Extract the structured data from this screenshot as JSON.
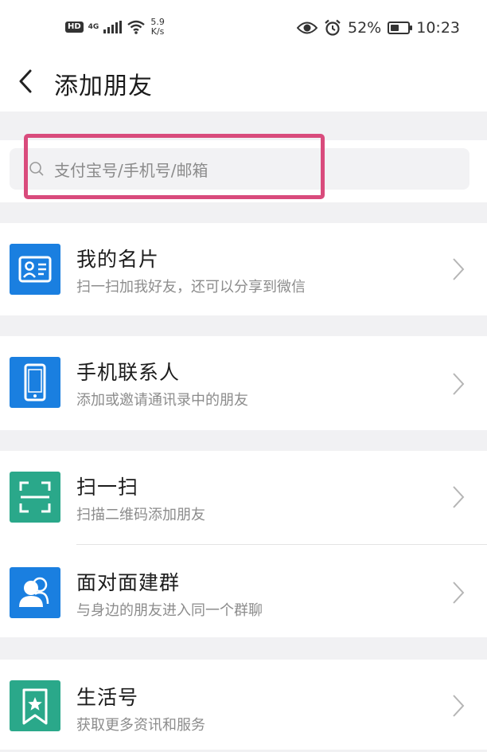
{
  "status_bar": {
    "hd": "HD",
    "network": "4G",
    "speed_value": "5.9",
    "speed_unit": "K/s",
    "battery": "52%",
    "battery_level": 0.52,
    "time": "10:23"
  },
  "header": {
    "title": "添加朋友"
  },
  "search": {
    "placeholder": "支付宝号/手机号/邮箱"
  },
  "items": [
    {
      "title": "我的名片",
      "subtitle": "扫一扫加我好友，还可以分享到微信",
      "icon": "contact-card-icon",
      "color": "#1a7fe0"
    },
    {
      "title": "手机联系人",
      "subtitle": "添加或邀请通讯录中的朋友",
      "icon": "phone-icon",
      "color": "#1a7fe0"
    },
    {
      "title": "扫一扫",
      "subtitle": "扫描二维码添加朋友",
      "icon": "scan-icon",
      "color": "#2aa88a"
    },
    {
      "title": "面对面建群",
      "subtitle": "与身边的朋友进入同一个群聊",
      "icon": "group-icon",
      "color": "#1a7fe0"
    },
    {
      "title": "生活号",
      "subtitle": "获取更多资讯和服务",
      "icon": "star-bookmark-icon",
      "color": "#2aa88a"
    }
  ],
  "colors": {
    "highlight": "#d94b7c",
    "blue": "#1a7fe0",
    "green": "#2aa88a"
  }
}
